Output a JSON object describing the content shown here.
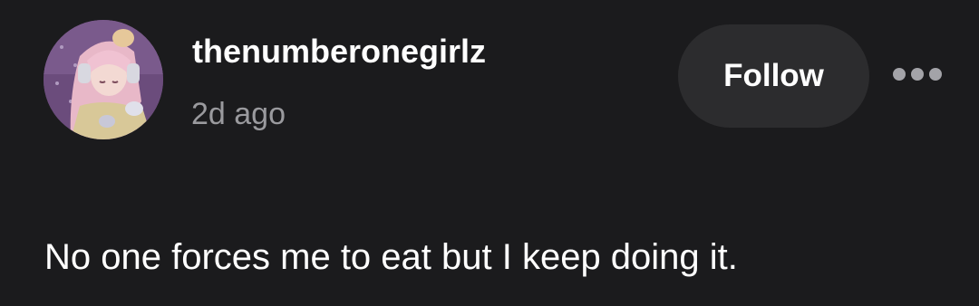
{
  "post": {
    "author": {
      "username": "thenumberonegirlz",
      "avatar_icon": "anime-character-avatar"
    },
    "timestamp": "2d ago",
    "follow_label": "Follow",
    "more_icon": "ellipsis-icon",
    "text": "No one forces me to eat but I keep doing it."
  },
  "colors": {
    "background": "#1b1b1d",
    "button_background": "#2c2c2e",
    "secondary_text": "#9a9a9e"
  }
}
